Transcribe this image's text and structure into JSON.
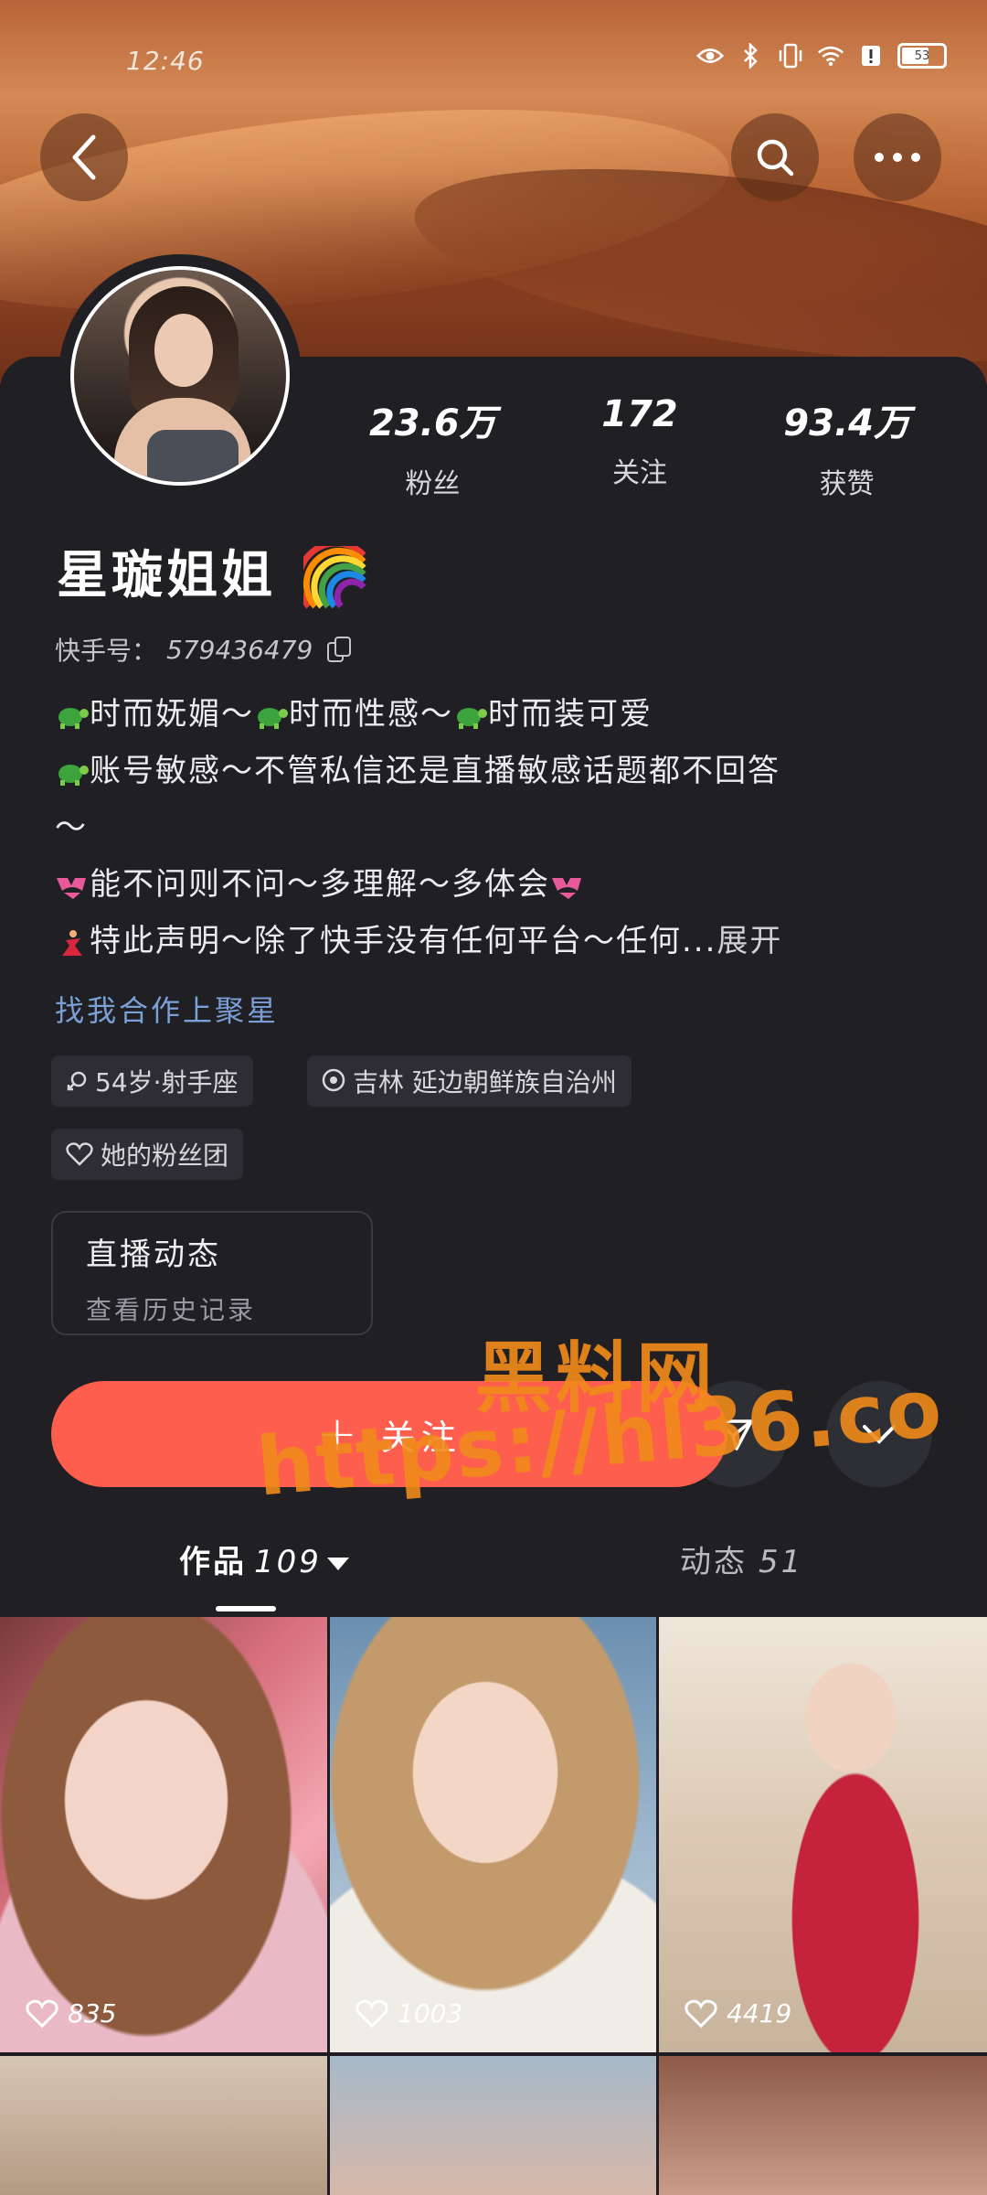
{
  "status": {
    "time": "12:46",
    "battery": "53"
  },
  "profile": {
    "name": "星璇姐姐",
    "id_label": "快手号：",
    "id_value": "579436479",
    "stats": [
      {
        "value": "23.6万",
        "label": "粉丝"
      },
      {
        "value": "172",
        "label": "关注"
      },
      {
        "value": "93.4万",
        "label": "获赞"
      }
    ],
    "bio": {
      "line1": "时而妩媚～",
      "line1b": "时而性感～",
      "line1c": "时而装可爱",
      "line2": "账号敏感～不管私信还是直播敏感话题都不回答",
      "line2b": "～",
      "line3": "能不问则不问～多理解～多体会",
      "line4": "特此声明～除了快手没有任何平台～任何...",
      "expand": "展开"
    },
    "business_link": "找我合作上聚星",
    "chips": {
      "age": "54岁·射手座",
      "location": "吉林 延边朝鲜族自治州",
      "fans_group": "她的粉丝团"
    },
    "live": {
      "title": "直播动态",
      "subtitle": "查看历史记录"
    },
    "follow_label": "关注"
  },
  "watermark": {
    "line1": "黑料网",
    "line2": "https://hl36.co"
  },
  "tabs": {
    "works_label": "作品",
    "works_count": "109",
    "dynamic_label": "动态",
    "dynamic_count": "51"
  },
  "grid": [
    {
      "likes": "835"
    },
    {
      "likes": "1003"
    },
    {
      "likes": "4419"
    }
  ]
}
